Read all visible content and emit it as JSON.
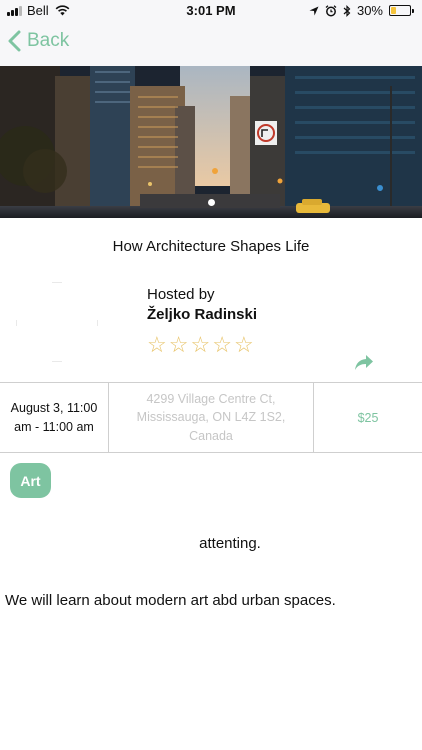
{
  "status_bar": {
    "carrier": "Bell",
    "time": "3:01 PM",
    "battery": "30%",
    "battery_level": 0.3,
    "icons": [
      "signal-icon",
      "wifi-icon",
      "location-icon",
      "alarm-icon",
      "bluetooth-icon",
      "battery-icon"
    ]
  },
  "nav": {
    "back_label": "Back",
    "accent_color": "#7ec4a1"
  },
  "hero": {
    "image_description_icon": "city-photo",
    "page_count": 1,
    "active_page": 1
  },
  "event": {
    "title": "How Architecture Shapes Life",
    "hosted_by_label": "Hosted by",
    "host_name": "Željko Radinski",
    "rating": 0,
    "rating_max": 5,
    "date_time": "August 3, 11:00 am - 11:00 am",
    "address": "4299 Village Centre Ct, Mississauga, ON L4Z 1S2, Canada",
    "price": "$25",
    "category": "Art",
    "attending_text": "attenting.",
    "description": "We will learn about modern art abd urban spaces."
  }
}
